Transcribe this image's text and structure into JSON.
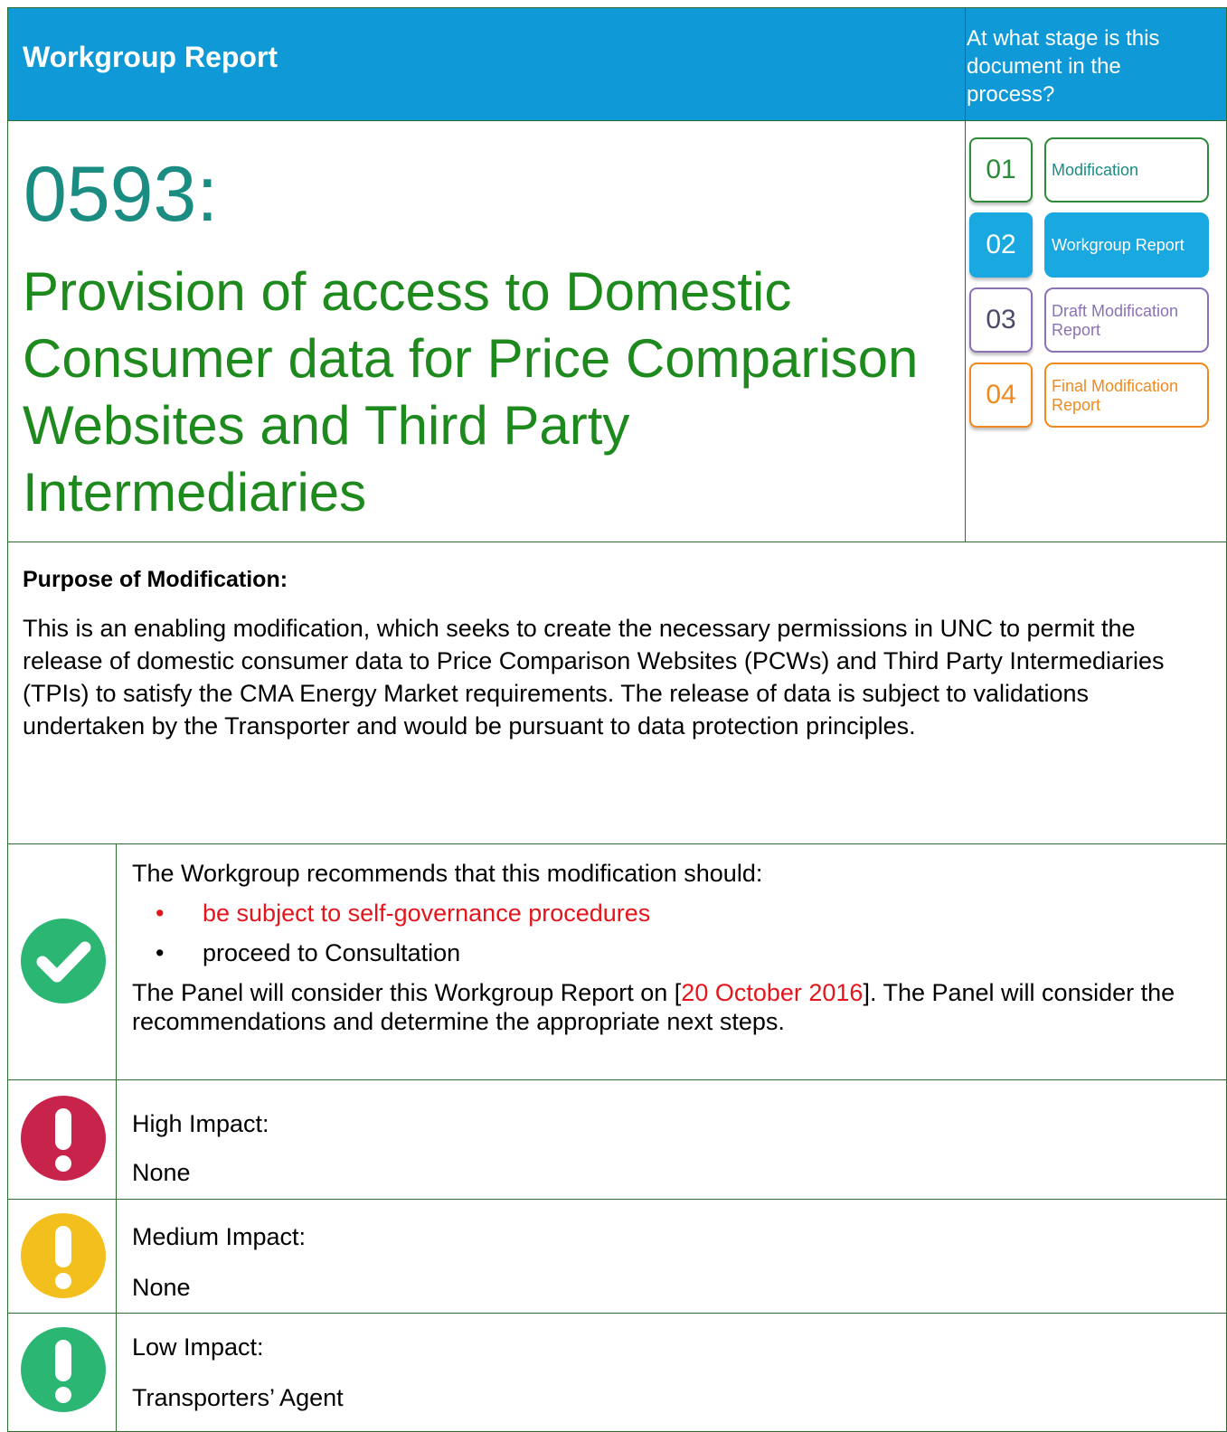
{
  "header": {
    "title": "Workgroup Report",
    "stage_question": "At what stage is this document in the process?"
  },
  "modification": {
    "number": "0593:",
    "title": "Provision of access to Domestic Consumer data for Price Comparison Websites and Third Party Intermediaries"
  },
  "stages": [
    {
      "number": "01",
      "label": "Modification",
      "color": "#2d8a3a",
      "active": false
    },
    {
      "number": "02",
      "label": "Workgroup Report",
      "color": "#19a8e0",
      "active": true
    },
    {
      "number": "03",
      "label": "Draft Modification Report",
      "color": "#8a72b5",
      "active": false
    },
    {
      "number": "04",
      "label": "Final Modification Report",
      "color": "#f08a1e",
      "active": false
    }
  ],
  "purpose": {
    "heading": "Purpose of Modification:",
    "text": "This is an enabling modification, which seeks to create the necessary permissions in UNC to permit the release of domestic consumer data to Price Comparison Websites (PCWs) and Third Party Intermediaries (TPIs) to satisfy the CMA Energy Market requirements. The release of data is subject to validations undertaken by the Transporter and would be pursuant to data protection principles."
  },
  "recommendation": {
    "icon": "check-circle-icon",
    "icon_color": "#2bb673",
    "intro": "The Workgroup recommends that this modification should:",
    "bullets": [
      {
        "text": "be subject to self-governance procedures",
        "color": "#e3161b"
      },
      {
        "text": "proceed to Consultation",
        "color": "#000000"
      }
    ],
    "panel_prefix": "The Panel will consider this Workgroup Report on [",
    "panel_date": "20 October 2016",
    "panel_suffix": "].  The Panel will consider the recommendations and determine the appropriate next steps."
  },
  "impacts": [
    {
      "label": "High Impact:",
      "value": "None",
      "icon": "exclamation-icon",
      "color": "#c8234a"
    },
    {
      "label": "Medium Impact:",
      "value": "None",
      "icon": "exclamation-icon",
      "color": "#f3bf1c"
    },
    {
      "label": "Low Impact:",
      "value": "Transporters’ Agent",
      "icon": "exclamation-icon",
      "color": "#2bb673"
    }
  ]
}
